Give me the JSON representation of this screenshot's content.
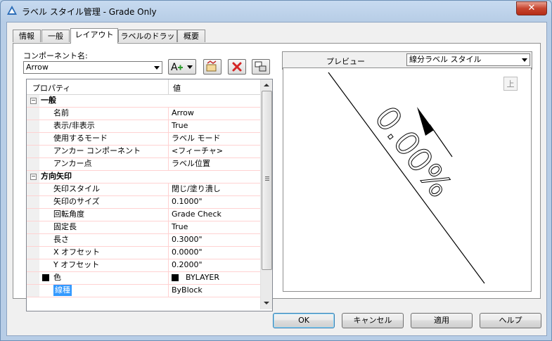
{
  "window": {
    "title": "ラベル スタイル管理 - Grade Only",
    "close_label": "✕"
  },
  "tabs": [
    {
      "label": "情報"
    },
    {
      "label": "一般"
    },
    {
      "label": "レイアウト"
    },
    {
      "label": "ラベルのドラッグ"
    },
    {
      "label": "概要"
    }
  ],
  "component": {
    "label": "コンポーネント名:",
    "value": "Arrow"
  },
  "grid": {
    "header_property": "プロパティ",
    "header_value": "値",
    "rows": [
      {
        "kind": "cat",
        "toggle": "⊟",
        "name": "一般",
        "value": ""
      },
      {
        "name": "名前",
        "value": "Arrow"
      },
      {
        "name": "表示/非表示",
        "value": "True"
      },
      {
        "name": "使用するモード",
        "value": "ラベル モード"
      },
      {
        "name": "アンカー コンポーネント",
        "value": "<フィーチャ>"
      },
      {
        "name": "アンカー点",
        "value": "ラベル位置"
      },
      {
        "kind": "cat",
        "toggle": "⊟",
        "name": "方向矢印",
        "value": ""
      },
      {
        "name": "矢印スタイル",
        "value": "閉じ/塗り潰し"
      },
      {
        "name": "矢印のサイズ",
        "value": "0.1000\""
      },
      {
        "name": "回転角度",
        "value": "Grade Check"
      },
      {
        "name": "固定長",
        "value": "True"
      },
      {
        "name": "長さ",
        "value": "0.3000\""
      },
      {
        "name": "X オフセット",
        "value": "0.0000\""
      },
      {
        "name": "Y オフセット",
        "value": "0.2000\""
      },
      {
        "name": "色",
        "value": "BYLAYER"
      },
      {
        "name": "線種",
        "value": "ByBlock"
      }
    ]
  },
  "preview": {
    "label": "プレビュー",
    "style_value": "線分ラベル スタイル",
    "top_button": "上",
    "sample_text": "0.00%"
  },
  "buttons": {
    "ok": "OK",
    "cancel": "キャンセル",
    "apply": "適用",
    "help": "ヘルプ"
  }
}
